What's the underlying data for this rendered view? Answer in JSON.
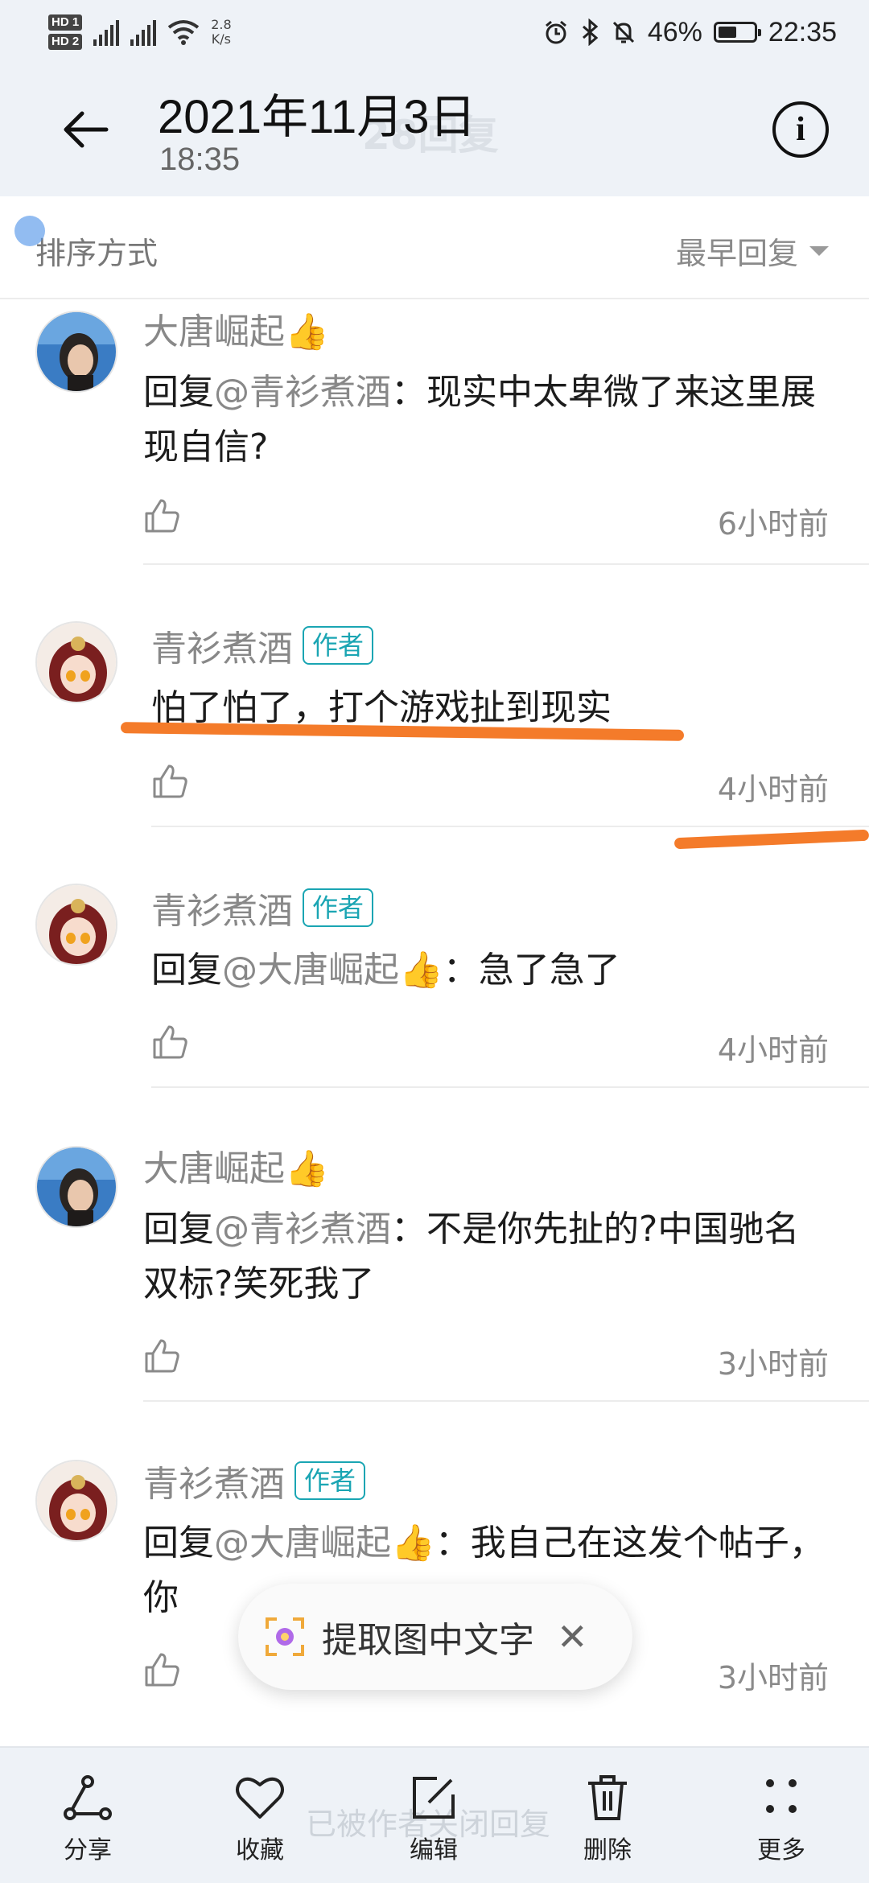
{
  "status": {
    "hd1": "HD 1",
    "hd2": "HD 2",
    "net_speed": "2.8",
    "net_unit": "K/s",
    "battery": "46%",
    "battery_level": 0.46,
    "time": "22:35"
  },
  "header": {
    "date": "2021年11月3日",
    "time": "18:35",
    "ghost_count": "28回复"
  },
  "sort": {
    "label": "排序方式",
    "value": "最早回复"
  },
  "comments": [
    {
      "name": "大唐崛起👍",
      "is_author": false,
      "reply_prefix": "回复",
      "reply_to": "@青衫煮酒",
      "text": "：现实中太卑微了来这里展现自信?",
      "time": "6小时前"
    },
    {
      "name": "青衫煮酒",
      "is_author": true,
      "badge": "作者",
      "text": "怕了怕了，打个游戏扯到现实",
      "time": "4小时前"
    },
    {
      "name": "青衫煮酒",
      "is_author": true,
      "badge": "作者",
      "reply_prefix": "回复",
      "reply_to": "@大唐崛起👍",
      "text": "：急了急了",
      "time": "4小时前"
    },
    {
      "name": "大唐崛起👍",
      "is_author": false,
      "reply_prefix": "回复",
      "reply_to": "@青衫煮酒",
      "text": "：不是你先扯的?中国驰名双标?笑死我了",
      "time": "3小时前"
    },
    {
      "name": "青衫煮酒",
      "is_author": true,
      "badge": "作者",
      "reply_prefix": "回复",
      "reply_to": "@大唐崛起👍",
      "text": "：我自己在这发个帖子，你",
      "time": "3小时前"
    }
  ],
  "toast": {
    "label": "提取图中文字",
    "close": "✕"
  },
  "bottom": {
    "ghost_text": "已被作者关闭回复",
    "share": "分享",
    "favorite": "收藏",
    "edit": "编辑",
    "delete": "删除",
    "more": "更多"
  },
  "colors": {
    "accent_badge": "#1aa5b3",
    "highlight_stroke": "#f47b2a",
    "bar_bg": "#eef2f7"
  }
}
